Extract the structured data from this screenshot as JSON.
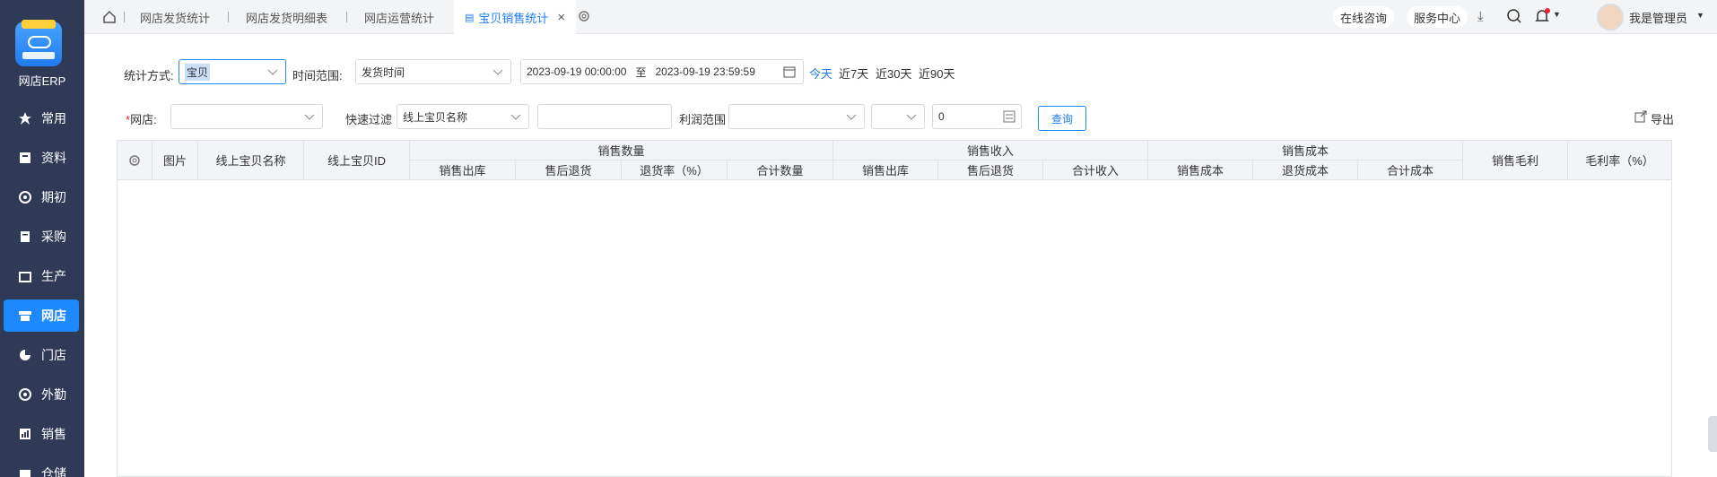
{
  "sidebar": {
    "brand": "网店ERP",
    "items": [
      {
        "label": "常用",
        "icon": "star-icon"
      },
      {
        "label": "资料",
        "icon": "doc-icon"
      },
      {
        "label": "期初",
        "icon": "clock-icon"
      },
      {
        "label": "采购",
        "icon": "purchase-icon"
      },
      {
        "label": "生产",
        "icon": "production-icon"
      },
      {
        "label": "网店",
        "icon": "store-icon"
      },
      {
        "label": "门店",
        "icon": "pie-icon"
      },
      {
        "label": "外勤",
        "icon": "compass-icon"
      },
      {
        "label": "销售",
        "icon": "chart-icon"
      },
      {
        "label": "仓储",
        "icon": "box-icon"
      }
    ]
  },
  "topbar": {
    "tabs": [
      "网店发货统计",
      "网店发货明细表",
      "网店运营统计",
      "宝贝销售统计"
    ],
    "close": "×",
    "consult": "在线咨询",
    "service": "服务中心",
    "user": "我是管理员"
  },
  "filters": {
    "stat_mode_label": "统计方式:",
    "stat_mode_value": "宝贝",
    "time_range_label": "时间范围:",
    "time_range_value": "发货时间",
    "date_start": "2023-09-19 00:00:00",
    "date_to": "至",
    "date_end": "2023-09-19 23:59:59",
    "quick": [
      "今天",
      "近7天",
      "近30天",
      "近90天"
    ],
    "store_label": "网店:",
    "quick_filter_label": "快速过滤",
    "quick_filter_value": "线上宝贝名称",
    "profit_label": "利润范围",
    "profit_value": "0",
    "query": "查询",
    "export": "导出"
  },
  "table": {
    "col_image": "图片",
    "col_name": "线上宝贝名称",
    "col_id": "线上宝贝ID",
    "group_qty": "销售数量",
    "group_income": "销售收入",
    "group_cost": "销售成本",
    "qty_cols": [
      "销售出库",
      "售后退货",
      "退货率（%）",
      "合计数量"
    ],
    "income_cols": [
      "销售出库",
      "售后退货",
      "合计收入"
    ],
    "cost_cols": [
      "销售成本",
      "退货成本",
      "合计成本"
    ],
    "col_gross": "销售毛利",
    "col_margin": "毛利率（%）"
  }
}
